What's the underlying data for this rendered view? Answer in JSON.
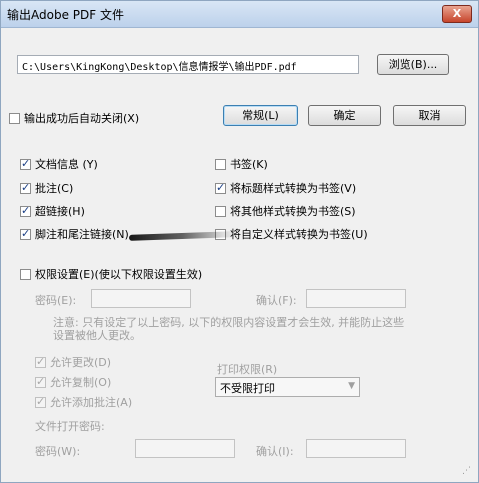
{
  "title": "输出Adobe PDF 文件",
  "close_label": "X",
  "output_path": "C:\\Users\\KingKong\\Desktop\\信息情报学\\输出PDF.pdf",
  "browse_label": "浏览(B)...",
  "auto_close_label": "输出成功后自动关闭(X)",
  "general_label": "常规(L)",
  "ok_label": "确定",
  "cancel_label": "取消",
  "options_left": [
    {
      "label": "文档信息 (Y)",
      "checked": true
    },
    {
      "label": "批注(C)",
      "checked": true
    },
    {
      "label": "超链接(H)",
      "checked": true
    },
    {
      "label": "脚注和尾注链接(N)",
      "checked": true
    }
  ],
  "options_right": [
    {
      "label": "书签(K)",
      "checked": false
    },
    {
      "label": "将标题样式转换为书签(V)",
      "checked": true
    },
    {
      "label": "将其他样式转换为书签(S)",
      "checked": false
    },
    {
      "label": "将自定义样式转换为书签(U)",
      "checked": false
    }
  ],
  "permission_label": "权限设置(E)(使以下权限设置生效)",
  "password_label": "密码(E):",
  "confirm_label": "确认(F):",
  "note_text": "注意: 只有设定了以上密码, 以下的权限内容设置才会生效, 并能防止这些设置被他人更改。",
  "allow_change": "允许更改(D)",
  "allow_copy": "允许复制(O)",
  "allow_annotate": "允许添加批注(A)",
  "print_perm_label": "打印权限(R)",
  "print_select_value": "不受限打印",
  "open_password_label": "文件打开密码:",
  "open_pwd_label": "密码(W):",
  "open_confirm_label": "确认(I):"
}
